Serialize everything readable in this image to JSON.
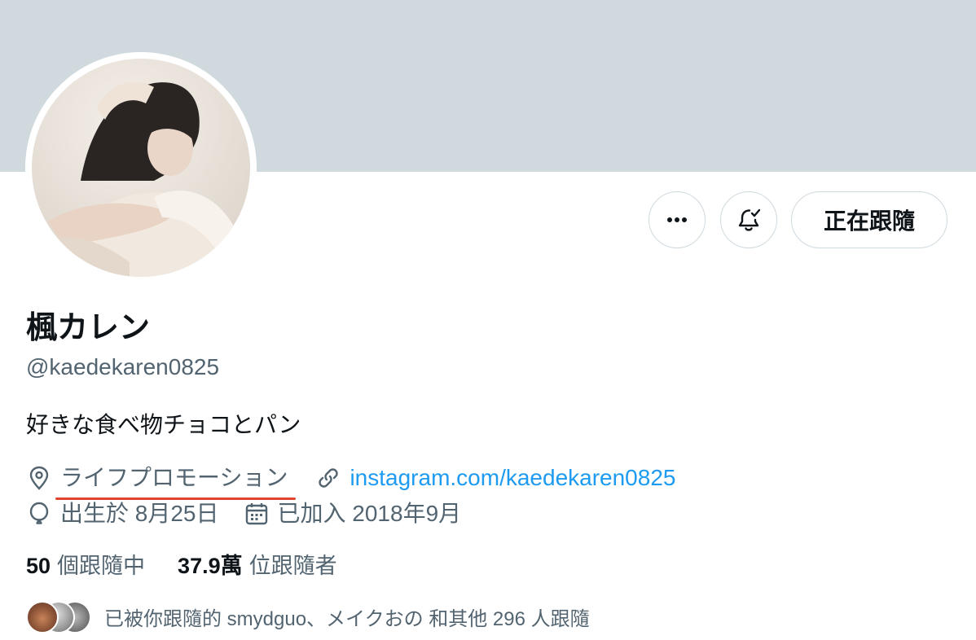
{
  "profile": {
    "display_name": "楓カレン",
    "handle": "@kaedekaren0825",
    "bio": "好きな食べ物チョコとパン",
    "location": "ライフプロモーション",
    "website": "instagram.com/kaedekaren0825",
    "birthday": "出生於 8月25日",
    "joined": "已加入 2018年9月"
  },
  "actions": {
    "more_icon": "more-icon",
    "bell_icon": "bell-subscribed-icon",
    "follow_label": "正在跟隨"
  },
  "stats": {
    "following_count": "50",
    "following_label": "個跟隨中",
    "followers_count": "37.9萬",
    "followers_label": "位跟隨者"
  },
  "followed_by": {
    "text": "已被你跟隨的 smydguo、メイクおの 和其他 296 人跟隨"
  },
  "colors": {
    "banner": "#cfd9de",
    "link": "#1d9bf0",
    "underline_annotation": "#e0442f",
    "secondary_text": "#536471"
  }
}
